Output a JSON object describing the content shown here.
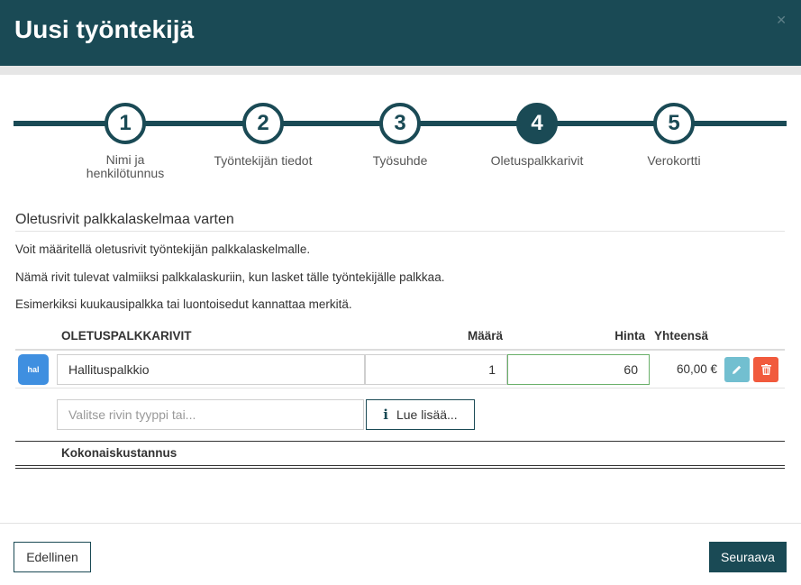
{
  "header": {
    "title": "Uusi työntekijä",
    "close_icon": "close-icon"
  },
  "stepper": {
    "steps": [
      {
        "number": "1",
        "label": "Nimi ja henkilötunnus",
        "active": false
      },
      {
        "number": "2",
        "label": "Työntekijän tiedot",
        "active": false
      },
      {
        "number": "3",
        "label": "Työsuhde",
        "active": false
      },
      {
        "number": "4",
        "label": "Oletuspalkkarivit",
        "active": true
      },
      {
        "number": "5",
        "label": "Verokortti",
        "active": false
      }
    ]
  },
  "section": {
    "title": "Oletusrivit palkkalaskelmaa varten",
    "paragraphs": [
      "Voit määritellä oletusrivit työntekijän palkkalaskelmalle.",
      "Nämä rivit tulevat valmiiksi palkkalaskuriin, kun lasket tälle työntekijälle palkkaa.",
      "Esimerkiksi kuukausipalkka tai luontoisedut kannattaa merkitä."
    ]
  },
  "table": {
    "headers": {
      "item": "OLETUSPALKKARIVIT",
      "qty": "Määrä",
      "price": "Hinta",
      "total": "Yhteensä"
    },
    "rows": [
      {
        "avatar": "hal",
        "name": "Hallituspalkkio",
        "qty": "1",
        "price": "60",
        "total": "60,00 €"
      }
    ],
    "new_row_placeholder": "Valitse rivin tyyppi tai...",
    "read_more_label": "Lue lisää...",
    "read_more_icon": "info-icon",
    "total_label": "Kokonaiskustannus"
  },
  "footer": {
    "prev_label": "Edellinen",
    "next_label": "Seuraava"
  },
  "colors": {
    "primary": "#1a4a55",
    "edit": "#72bfd0",
    "delete": "#f15a3d",
    "avatar": "#3f8fe0",
    "price_border": "#6ab06a"
  }
}
